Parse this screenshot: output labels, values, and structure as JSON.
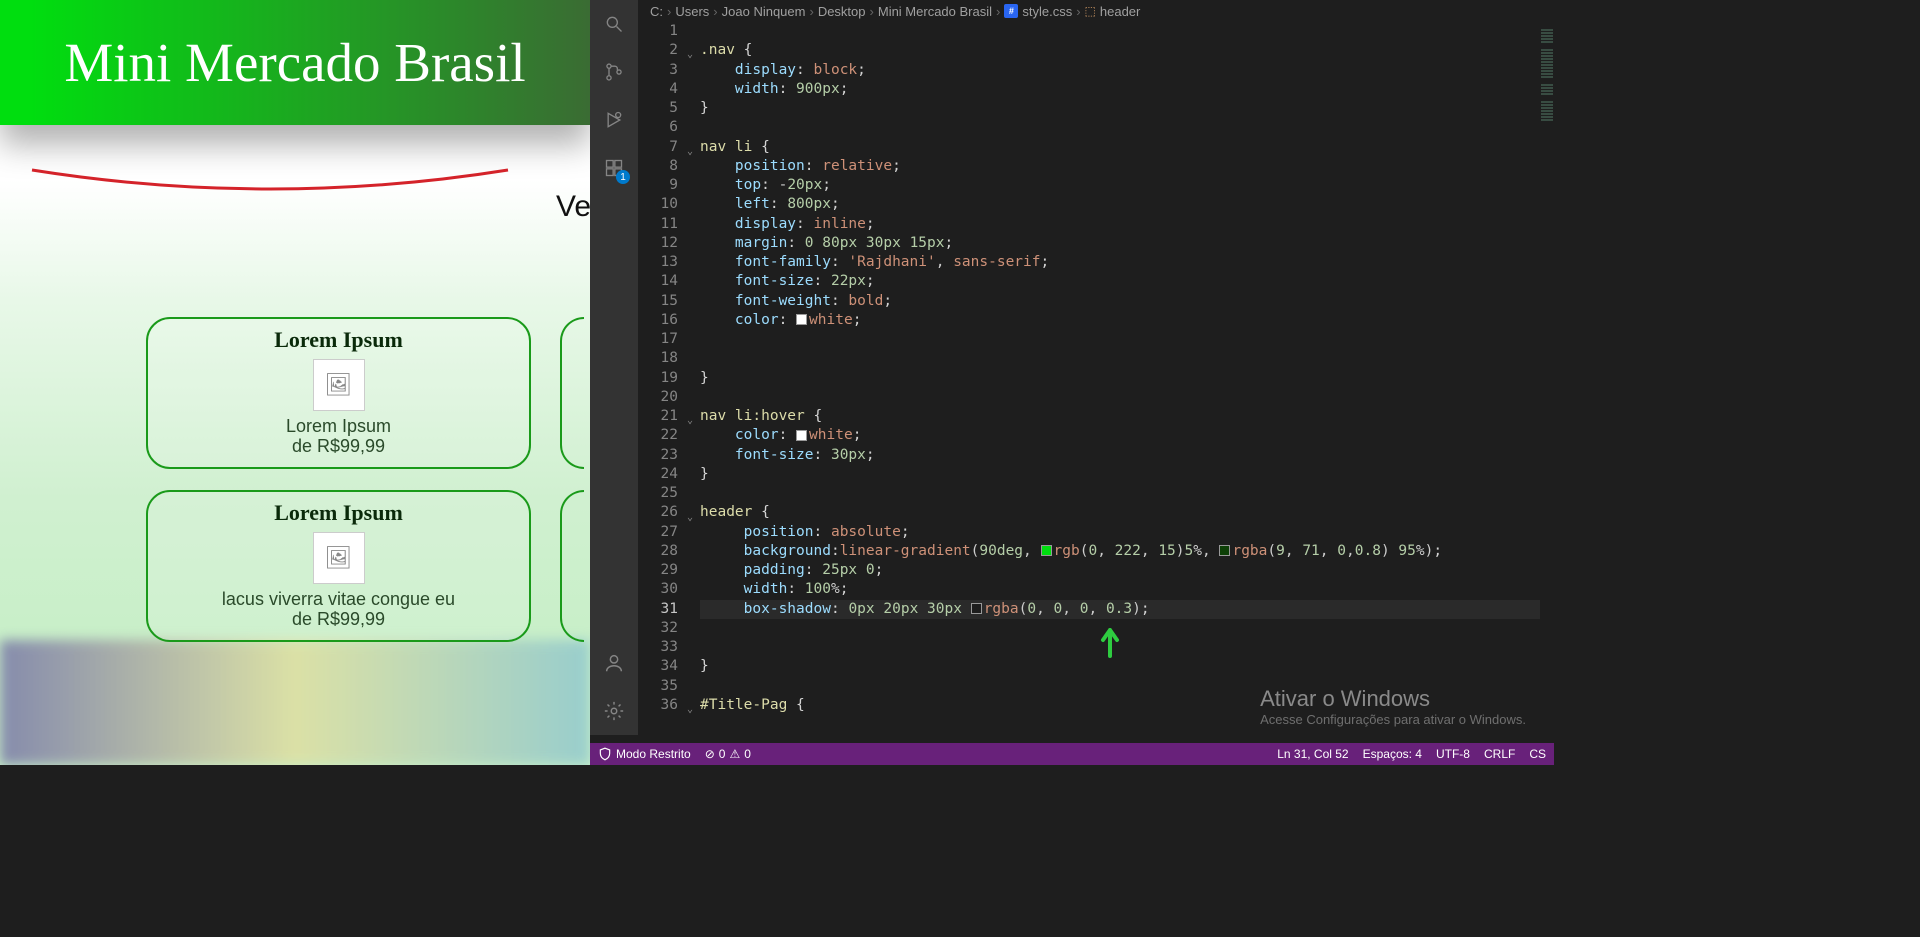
{
  "preview": {
    "header_title": "Mini Mercado Brasil",
    "ve_text": "Ve",
    "cards": [
      {
        "title": "Lorem Ipsum",
        "line1": "Lorem Ipsum",
        "line2": "de R$99,99"
      },
      {
        "title": "Lorem Ipsum",
        "line1": "lacus viverra vitae congue eu",
        "line2": "de R$99,99"
      }
    ]
  },
  "breadcrumb": {
    "parts": [
      "C:",
      "Users",
      "Joao Ninquem",
      "Desktop",
      "Mini Mercado Brasil"
    ],
    "file": "style.css",
    "symbol": "header"
  },
  "activity": {
    "ext_badge": "1"
  },
  "code": {
    "lines": [
      {
        "n": 1,
        "t": ""
      },
      {
        "n": 2,
        "t": ".nav {",
        "fold": true
      },
      {
        "n": 3,
        "t": "    display: block;"
      },
      {
        "n": 4,
        "t": "    width: 900px;"
      },
      {
        "n": 5,
        "t": "}"
      },
      {
        "n": 6,
        "t": ""
      },
      {
        "n": 7,
        "t": "nav li {",
        "fold": true
      },
      {
        "n": 8,
        "t": "    position: relative;"
      },
      {
        "n": 9,
        "t": "    top: -20px;"
      },
      {
        "n": 10,
        "t": "    left: 800px;"
      },
      {
        "n": 11,
        "t": "    display: inline;"
      },
      {
        "n": 12,
        "t": "    margin: 0 80px 30px 15px;"
      },
      {
        "n": 13,
        "t": "    font-family: 'Rajdhani', sans-serif;"
      },
      {
        "n": 14,
        "t": "    font-size: 22px;"
      },
      {
        "n": 15,
        "t": "    font-weight: bold;"
      },
      {
        "n": 16,
        "t": "    color: white;",
        "cb": "#ffffff"
      },
      {
        "n": 17,
        "t": ""
      },
      {
        "n": 18,
        "t": ""
      },
      {
        "n": 19,
        "t": "}"
      },
      {
        "n": 20,
        "t": ""
      },
      {
        "n": 21,
        "t": "nav li:hover {",
        "fold": true
      },
      {
        "n": 22,
        "t": "    color: white;",
        "cb": "#ffffff"
      },
      {
        "n": 23,
        "t": "    font-size: 30px;"
      },
      {
        "n": 24,
        "t": "}"
      },
      {
        "n": 25,
        "t": ""
      },
      {
        "n": 26,
        "t": "header {",
        "fold": true
      },
      {
        "n": 27,
        "t": "     position: absolute;"
      },
      {
        "n": 28,
        "t": "     background:linear-gradient(90deg, rgb(0, 222, 15)5%, rgba(9, 71, 0,0.8) 95%);",
        "cb2": [
          "#00de0f",
          "#094700cc"
        ]
      },
      {
        "n": 29,
        "t": "     padding: 25px 0;"
      },
      {
        "n": 30,
        "t": "     width: 100%;"
      },
      {
        "n": 31,
        "t": "     box-shadow: 0px 20px 30px rgba(0, 0, 0, 0.3);",
        "cb": "#0000004d",
        "current": true
      },
      {
        "n": 32,
        "t": ""
      },
      {
        "n": 33,
        "t": ""
      },
      {
        "n": 34,
        "t": "}"
      },
      {
        "n": 35,
        "t": ""
      },
      {
        "n": 36,
        "t": "#Title-Pag {",
        "fold": true
      }
    ]
  },
  "status": {
    "restricted": "Modo Restrito",
    "errors": "0",
    "warnings": "0",
    "lncol": "Ln 31, Col 52",
    "spaces": "Espaços: 4",
    "encoding": "UTF-8",
    "eol": "CRLF",
    "lang": "CS"
  },
  "watermark": {
    "title": "Ativar o Windows",
    "sub": "Acesse Configurações para ativar o Windows."
  }
}
